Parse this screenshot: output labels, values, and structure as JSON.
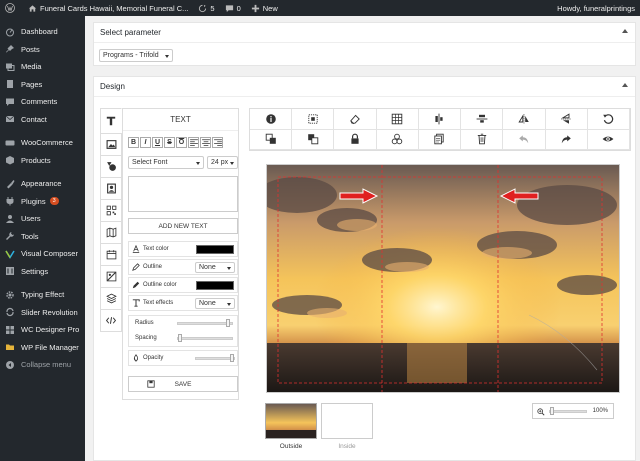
{
  "adminbar": {
    "site_name": "Funeral Cards Hawaii, Memorial Funeral C...",
    "updates_count": "5",
    "comments_count": "0",
    "new_label": "New",
    "howdy": "Howdy, funeralprintings"
  },
  "sidebar": {
    "items": [
      {
        "label": "Dashboard",
        "icon": "dashboard-icon"
      },
      {
        "label": "Posts",
        "icon": "pin-icon"
      },
      {
        "label": "Media",
        "icon": "media-icon"
      },
      {
        "label": "Pages",
        "icon": "pages-icon"
      },
      {
        "label": "Comments",
        "icon": "comment-icon"
      },
      {
        "label": "Contact",
        "icon": "mail-icon"
      },
      {
        "label": "WooCommerce",
        "icon": "woo-icon"
      },
      {
        "label": "Products",
        "icon": "products-icon"
      },
      {
        "label": "Appearance",
        "icon": "brush-icon"
      },
      {
        "label": "Plugins",
        "icon": "plug-icon",
        "badge": "3"
      },
      {
        "label": "Users",
        "icon": "user-icon"
      },
      {
        "label": "Tools",
        "icon": "wrench-icon"
      },
      {
        "label": "Visual Composer",
        "icon": "vc-icon"
      },
      {
        "label": "Settings",
        "icon": "settings-icon"
      },
      {
        "label": "Typing Effect",
        "icon": "gear-icon"
      },
      {
        "label": "Slider Revolution",
        "icon": "refresh-icon"
      },
      {
        "label": "WC Designer Pro",
        "icon": "grid-icon"
      },
      {
        "label": "WP File Manager",
        "icon": "folder-icon"
      },
      {
        "label": "Collapse menu",
        "icon": "collapse-icon"
      }
    ]
  },
  "parameter_box": {
    "title": "Select parameter",
    "selected": "Programs - Trifold"
  },
  "design_box": {
    "title": "Design",
    "panel_title": "TEXT",
    "format_buttons": [
      "B",
      "I",
      "U",
      "S",
      "O"
    ],
    "font_select": "Select Font",
    "size_select": "24 px",
    "add_text_label": "ADD NEW TEXT",
    "text_color_label": "Text color",
    "outline_label": "Outline",
    "outline_value": "None",
    "outline_color_label": "Outline color",
    "text_effects_label": "Text effects",
    "text_effects_value": "None",
    "radius_label": "Radius",
    "spacing_label": "Spacing",
    "opacity_label": "Opacity",
    "save_label": "SAVE",
    "text_color": "#000000",
    "outline_color": "#000000",
    "radius_level": 0.95,
    "spacing_level": 0.0,
    "opacity_level": 1.0
  },
  "views": [
    {
      "label": "Outside"
    },
    {
      "label": "Inside"
    }
  ],
  "zoom": {
    "value": "100%",
    "level": 0.0
  }
}
